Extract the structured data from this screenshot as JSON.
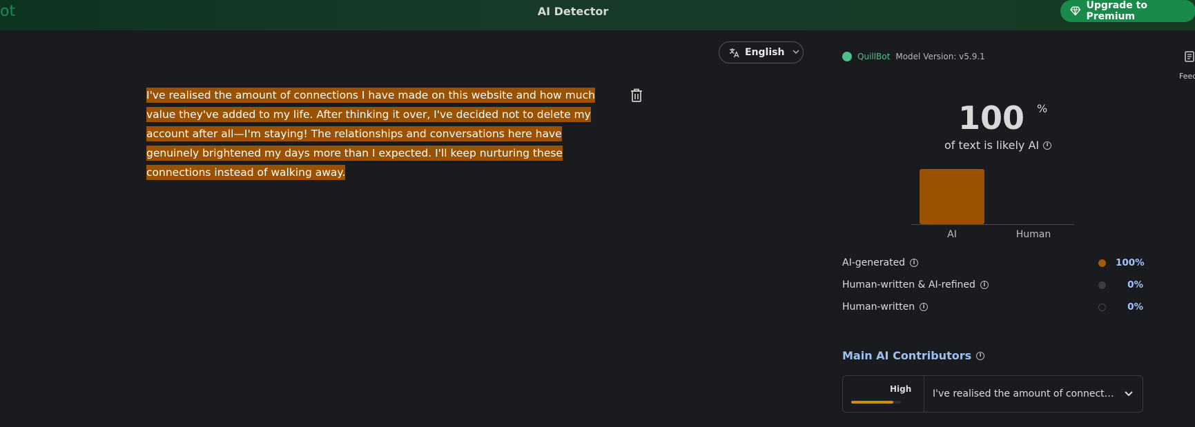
{
  "header": {
    "logo_partial": "ot",
    "title": "AI Detector",
    "upgrade_label": "Upgrade to Premium"
  },
  "editor": {
    "language_label": "English",
    "text": "I've realised the amount of connections I have made on this website and how much value they've added to my life. After thinking it over, I've decided not to delete my account after all—I'm staying! The relationships and conversations here have genuinely brightened my days more than I expected. I'll keep nurturing these connections instead of walking away."
  },
  "result": {
    "brand": "QuillBot",
    "model_version": "Model Version: v5.9.1",
    "side_label_partial": "Feed",
    "percent_value": "100",
    "percent_sign": "%",
    "likely_label": "of text is likely AI",
    "chart_data": {
      "type": "bar",
      "categories": [
        "AI",
        "Human"
      ],
      "values": [
        100,
        0
      ],
      "ylim": [
        0,
        100
      ],
      "colors": [
        "#9a5200",
        "#9a5200"
      ]
    },
    "legend": [
      {
        "label": "AI-generated",
        "value": "100%",
        "color": "#a35a10"
      },
      {
        "label": "Human-written & AI-refined",
        "value": "0%",
        "color": "#3a3b3f"
      },
      {
        "label": "Human-written",
        "value": "0%",
        "color": "#1a1b1e"
      }
    ],
    "contributors": {
      "title": "Main AI Contributors",
      "level_label": "High",
      "level_fraction": 0.85,
      "snippet": "I've realised the amount of connecti..."
    }
  },
  "colors": {
    "accent_green": "#1a8a4a",
    "highlight": "#9a5200",
    "link_blue": "#9cc1f0"
  }
}
